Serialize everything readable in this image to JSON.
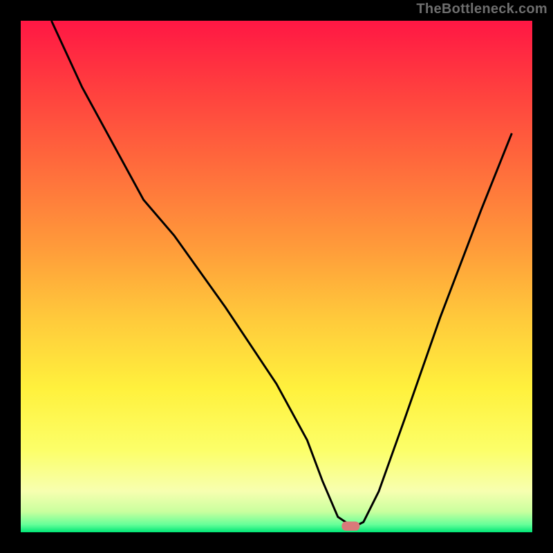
{
  "watermark": "TheBottleneck.com",
  "chart_data": {
    "type": "line",
    "title": "",
    "xlabel": "",
    "ylabel": "",
    "xlim": [
      0,
      100
    ],
    "ylim": [
      0,
      100
    ],
    "grid": false,
    "legend": false,
    "annotations": [],
    "background_gradient": {
      "stops": [
        {
          "offset": 0.0,
          "color": "#ff1744"
        },
        {
          "offset": 0.12,
          "color": "#ff3b3f"
        },
        {
          "offset": 0.28,
          "color": "#ff6a3c"
        },
        {
          "offset": 0.44,
          "color": "#ff9a3a"
        },
        {
          "offset": 0.58,
          "color": "#ffc93b"
        },
        {
          "offset": 0.72,
          "color": "#fff13d"
        },
        {
          "offset": 0.84,
          "color": "#fcff69"
        },
        {
          "offset": 0.92,
          "color": "#f7ffb0"
        },
        {
          "offset": 0.96,
          "color": "#c9ff9e"
        },
        {
          "offset": 0.985,
          "color": "#66ff99"
        },
        {
          "offset": 1.0,
          "color": "#00e676"
        }
      ]
    },
    "series": [
      {
        "name": "bottleneck-curve",
        "color": "#000000",
        "x": [
          6,
          12,
          24,
          30,
          40,
          50,
          56,
          59,
          62,
          65,
          67,
          70,
          75,
          82,
          90,
          96
        ],
        "y": [
          100,
          87,
          65,
          58,
          44,
          29,
          18,
          10,
          3,
          1,
          2,
          8,
          22,
          42,
          63,
          78
        ]
      }
    ],
    "marker": {
      "name": "optimal-point",
      "x": 64.5,
      "y": 1.2,
      "width": 3.5,
      "height": 1.8,
      "color": "#d97a7a"
    }
  }
}
